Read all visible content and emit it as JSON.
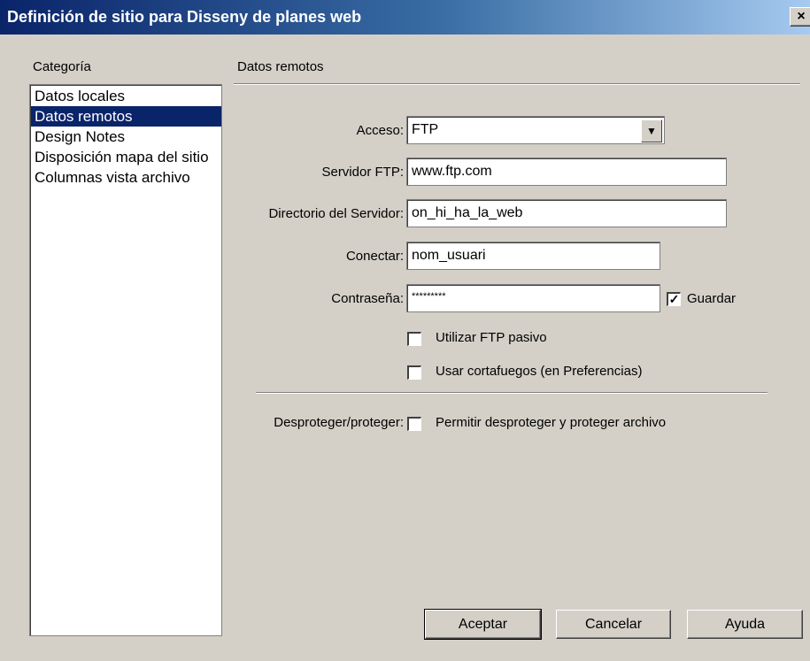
{
  "window": {
    "title": "Definición de sitio para Disseny de planes web",
    "close_glyph": "×"
  },
  "sidebar": {
    "heading": "Categoría",
    "items": [
      {
        "label": "Datos locales"
      },
      {
        "label": "Datos remotos",
        "selected": true
      },
      {
        "label": "Design Notes"
      },
      {
        "label": "Disposición mapa del sitio"
      },
      {
        "label": "Columnas vista archivo"
      }
    ]
  },
  "section": {
    "title": "Datos remotos"
  },
  "form": {
    "access": {
      "label": "Acceso:",
      "value": "FTP"
    },
    "ftp_server": {
      "label": "Servidor FTP:",
      "value": "www.ftp.com"
    },
    "server_dir": {
      "label": "Directorio del Servidor:",
      "value": "on_hi_ha_la_web"
    },
    "login": {
      "label": "Conectar:",
      "value": "nom_usuari"
    },
    "password": {
      "label": "Contraseña:",
      "value": "*********"
    },
    "save": {
      "label": "Guardar",
      "checked": true
    },
    "passive_ftp": {
      "label": "Utilizar FTP pasivo",
      "checked": false
    },
    "firewall": {
      "label": "Usar cortafuegos (en Preferencias)",
      "checked": false
    },
    "checkout": {
      "label": "Desproteger/proteger:",
      "option": "Permitir desproteger y proteger archivo",
      "checked": false
    }
  },
  "buttons": {
    "ok": "Aceptar",
    "cancel": "Cancelar",
    "help": "Ayuda"
  },
  "icons": {
    "dropdown": "chevron-down-icon",
    "check": "checkmark-icon"
  },
  "colors": {
    "selection": "#0a246a",
    "face": "#d4d0c8"
  }
}
